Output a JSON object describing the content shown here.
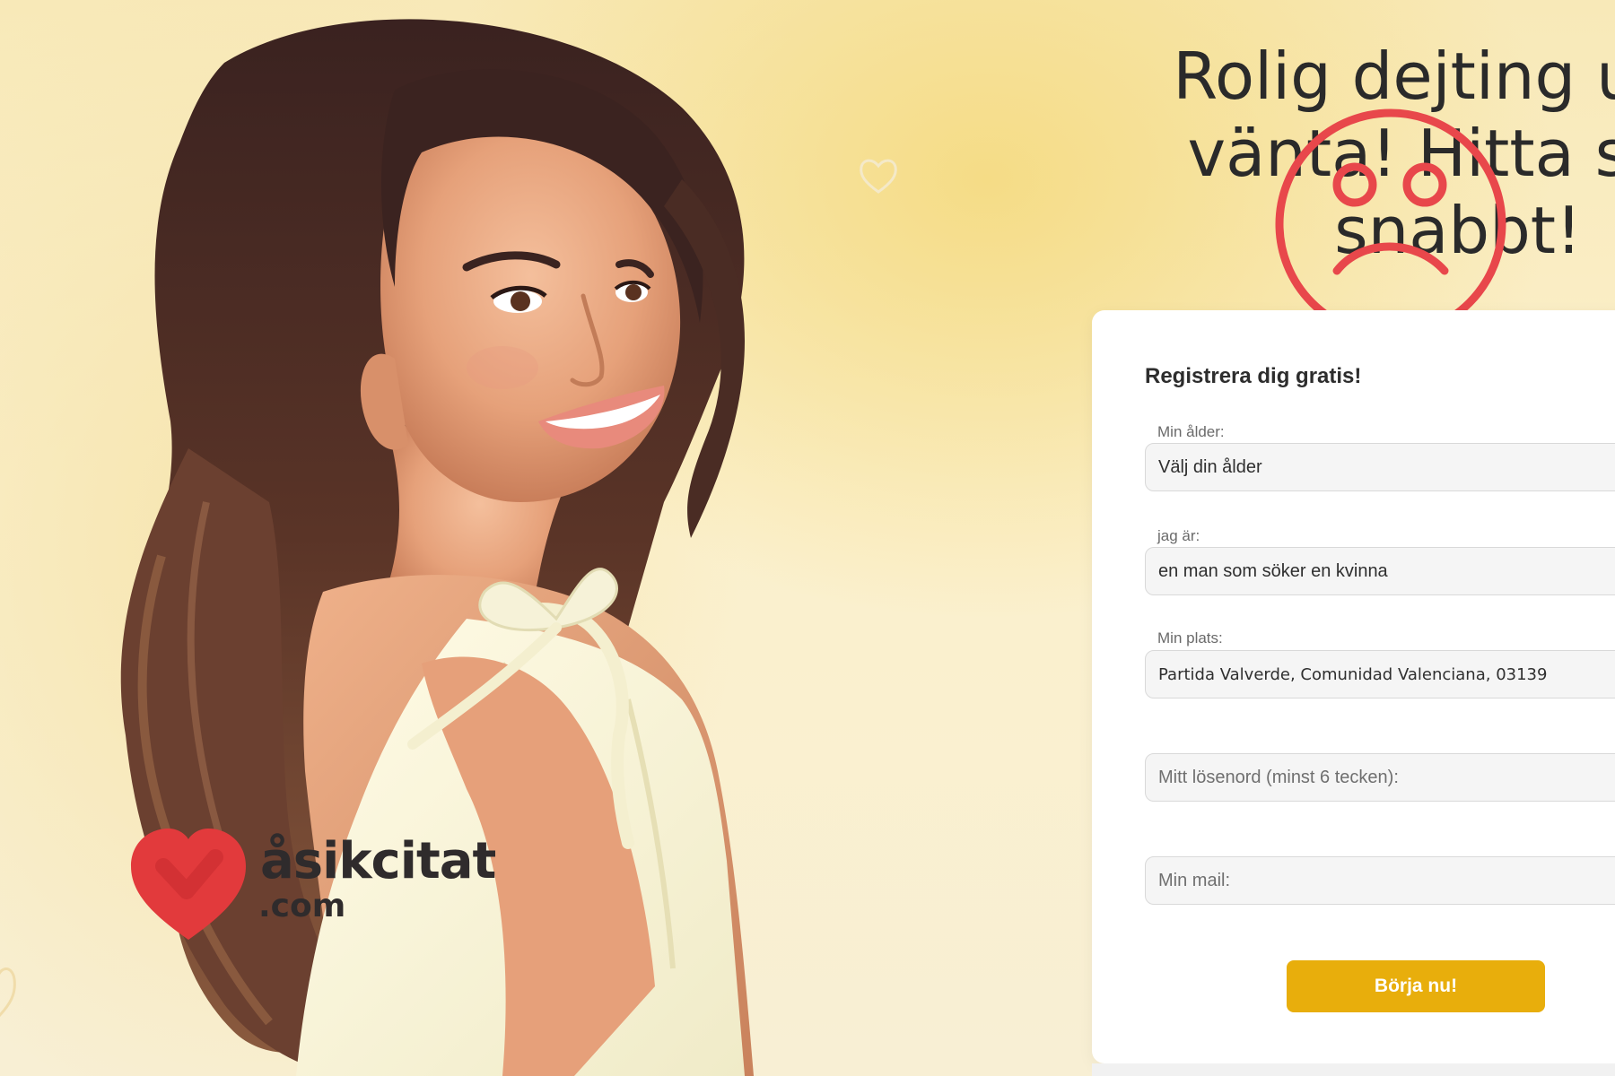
{
  "headline": {
    "text": "Rolig dejting utan\nvänta! Hitta sing\nsnabbt!"
  },
  "brand": {
    "name": "åsikcitat",
    "tld": ".com",
    "heart_color": "#e23a3c"
  },
  "registration": {
    "title": "Registrera dig gratis!",
    "age": {
      "label": "Min ålder:",
      "value": "Välj din ålder"
    },
    "gender": {
      "label": "jag är:",
      "value": "en man som söker en kvinna"
    },
    "location": {
      "label": "Min plats:",
      "value": "Partida Valverde, Comunidad Valenciana, 03139"
    },
    "password": {
      "placeholder": "Mitt lösenord (minst 6 tecken):"
    },
    "email": {
      "placeholder": "Min mail:"
    },
    "submit_label": "Börja nu!"
  },
  "colors": {
    "accent": "#e8ae0c",
    "sad_face": "#e8474b"
  },
  "icons": {
    "sad_face": "sad-face-icon",
    "background_hearts": "heart-outline-icon"
  }
}
